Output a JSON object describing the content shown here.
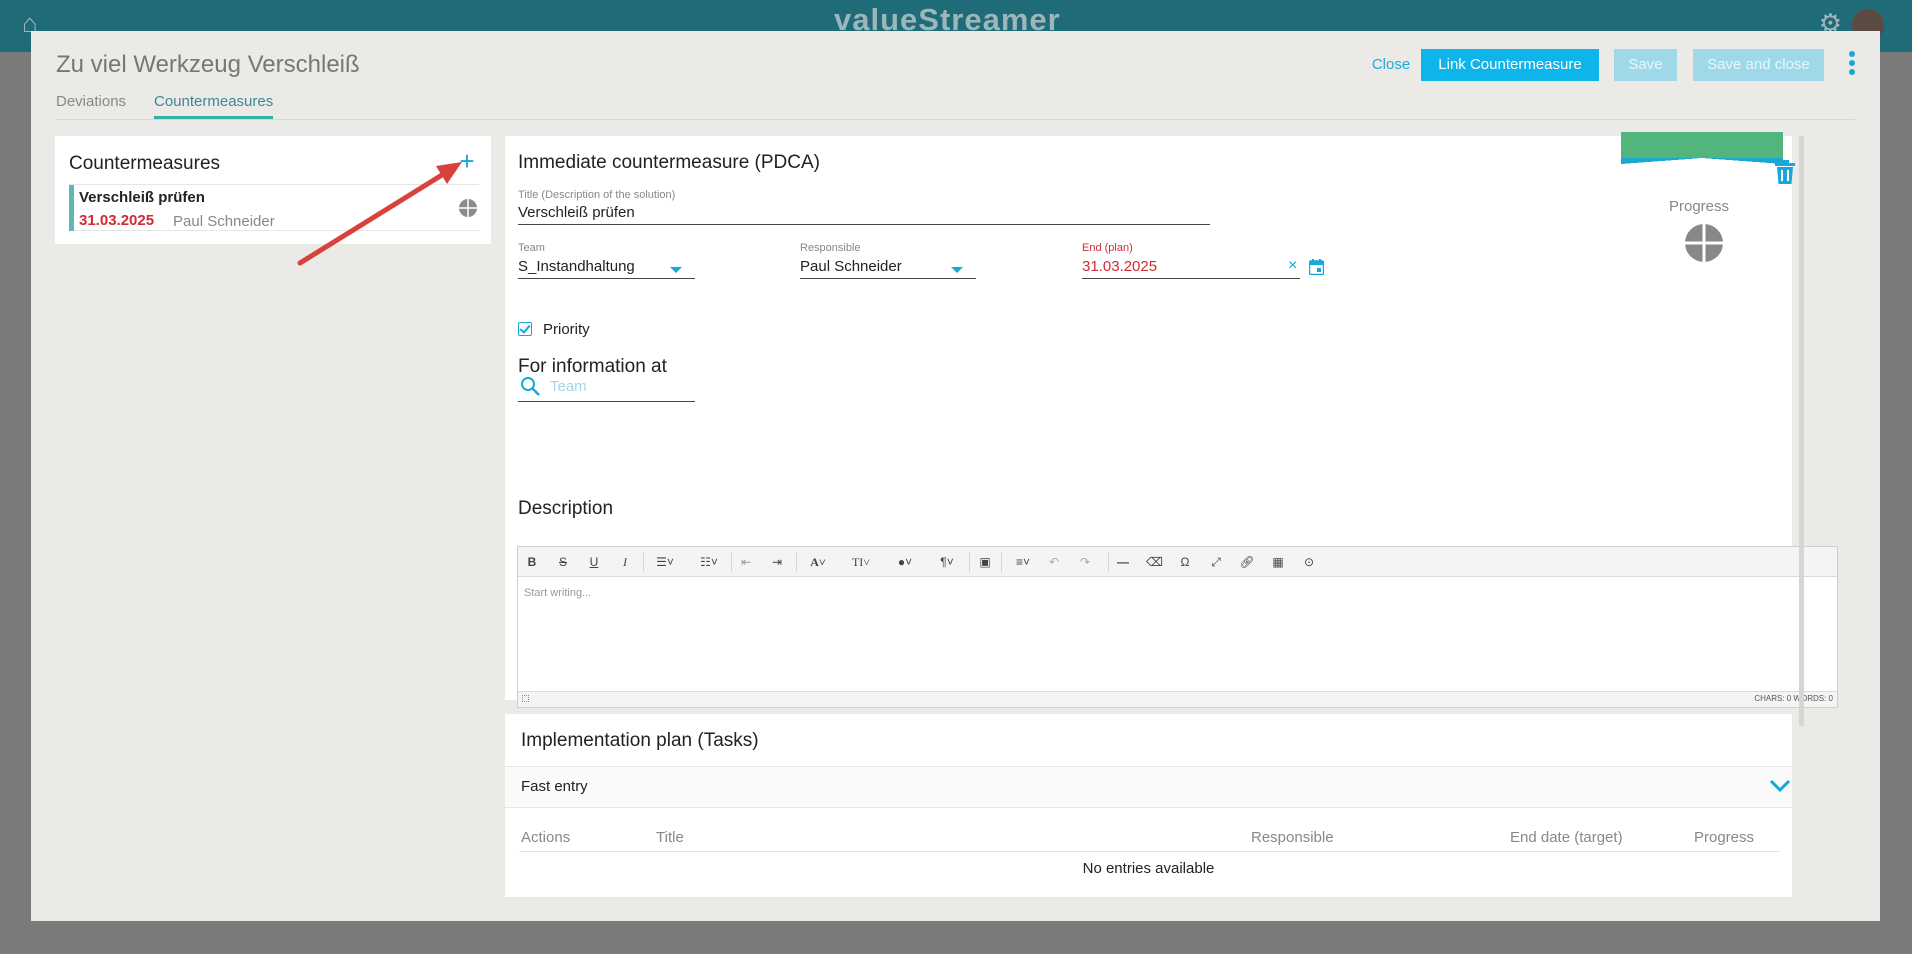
{
  "app": {
    "logo_text": "valueStreamer"
  },
  "modal": {
    "title": "Zu viel Werkzeug Verschleiß",
    "tabs": [
      {
        "label": "Deviations",
        "active": false
      },
      {
        "label": "Countermeasures",
        "active": true
      }
    ],
    "actions": {
      "close": "Close",
      "link": "Link Countermeasure",
      "save": "Save",
      "save_close": "Save and close"
    }
  },
  "countermeasures": {
    "heading": "Countermeasures",
    "items": [
      {
        "title": "Verschleiß prüfen",
        "date": "31.03.2025",
        "person": "Paul Schneider"
      }
    ]
  },
  "detail": {
    "title": "Immediate countermeasure (PDCA)",
    "progress_label": "Progress",
    "title_field": {
      "label": "Title (Description of the solution)",
      "value": "Verschleiß prüfen"
    },
    "team_field": {
      "label": "Team",
      "value": "S_Instandhaltung"
    },
    "responsible_field": {
      "label": "Responsible",
      "value": "Paul Schneider"
    },
    "end_field": {
      "label": "End (plan)",
      "value": "31.03.2025"
    },
    "priority_label": "Priority",
    "priority_checked": true,
    "info_heading": "For information at",
    "team_search_placeholder": "Team",
    "description_heading": "Description",
    "editor_placeholder": "Start writing...",
    "editor_stats": "CHARS: 0   WORDS: 0"
  },
  "implementation": {
    "title": "Implementation plan (Tasks)",
    "fast_entry": "Fast entry",
    "columns": [
      "Actions",
      "Title",
      "Responsible",
      "End date (target)",
      "Progress"
    ],
    "empty_text": "No entries available"
  },
  "colors": {
    "accent": "#14a9d8",
    "due_red": "#d12b35",
    "progress_green": "#52b57b",
    "item_bar": "#5cb8b0"
  }
}
